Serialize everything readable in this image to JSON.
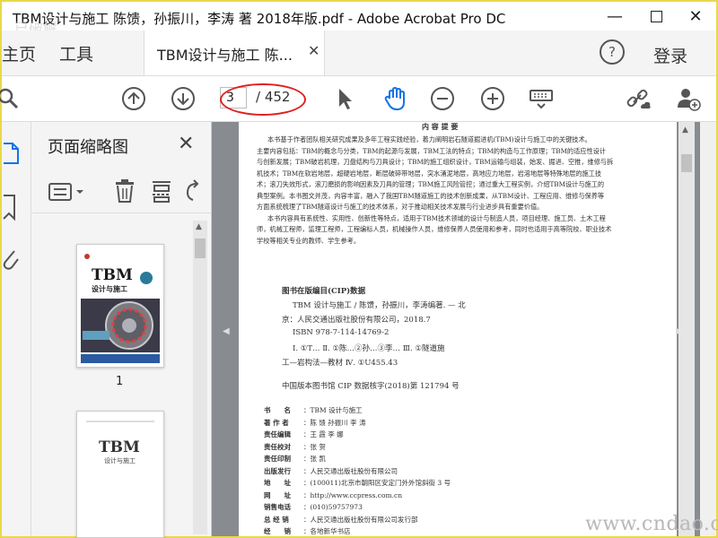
{
  "window": {
    "title": "TBM设计与施工 陈馈，孙振川，李涛 著 2018年版.pdf - Adobe Acrobat Pro DC",
    "corner_logo": "已破解"
  },
  "tabs": {
    "home": "主页",
    "tools": "工具",
    "document": "TBM设计与施工 陈...",
    "login": "登录"
  },
  "toolbar": {
    "page_current": "3",
    "page_total": "/ 452"
  },
  "thumbnail_panel": {
    "title": "页面缩略图",
    "thumbnails": [
      {
        "label": "1",
        "cover_title": "TBM",
        "cover_subtitle": "设计与施工"
      },
      {
        "label": "",
        "cover_title": "TBM",
        "cover_subtitle": "设计与施工"
      }
    ]
  },
  "document": {
    "summary_heading": "内 容 提 要",
    "summary_lines": [
      "本书基于作者团队相关研究成果及多年工程实践经验，着力阐明岩石隧道掘进机(TBM)设计与施工中的关键技术。",
      "主要内容包括：TBM的概念与分类，TBM的起源与发展，TBM工法的特点；TBM的构造与工作原理；TBM的适应性设计",
      "与创新发展；TBM破岩机理，刀盘结构与刀具设计；TBM的施工组织设计，TBM运输与组装，始发、掘进、空推，维修与拆",
      "机技术；TBM在软岩地层，超硬岩地层，断层破碎带地层，突水涌泥地层，高地应力地层，岩溶地层等特殊地层的施工技",
      "术；滚刀失效形式，滚刀磨损的影响因素及刀具的管理；TBM施工风险管控；通过重大工程实例，介绍TBM设计与施工的",
      "典型案例。本书图文并茂，内容丰富，融入了我国TBM隧道施工的技术创新成果，从TBM设计、工程应用、维修与保养等",
      "方面系统梳理了TBM隧道设计与施工的技术体系，对于推动相关技术发展与行业进步具有重要价值。",
      "本书内容具有系统性、实用性、创新性等特点，适用于TBM技术领域的设计与制造人员，项目经理、施工员、土木工程",
      "师，机械工程师，监理工程师，工程编标人员，机械操作人员，维修保养人员使用和参考，同时也适用于高等院校、职业技术",
      "学校等相关专业的教师、学生参考。"
    ],
    "cip_heading": "图书在版编目(CIP)数据",
    "cip_lines": [
      "TBM 设计与施工 / 陈馈，孙振川，李涛编著. — 北",
      "京：人民交通出版社股份有限公司，2018.7",
      "ISBN 978-7-114-14769-2",
      "Ⅰ. ①T…  Ⅱ. ①陈…②孙…③李…  Ⅲ. ①隧道施",
      "工—岩构法—教材  Ⅳ. ①U455.43",
      "中国版本图书馆 CIP 数据核字(2018)第 121794 号"
    ],
    "meta": [
      {
        "k": "书　　名",
        "v": "TBM 设计与施工"
      },
      {
        "k": "著 作 者",
        "v": "陈 馈  孙振川  李 涛"
      },
      {
        "k": "责任编辑",
        "v": "王 霞  李 娜"
      },
      {
        "k": "责任校对",
        "v": "张 贺"
      },
      {
        "k": "责任印制",
        "v": "张 凯"
      },
      {
        "k": "出版发行",
        "v": "人民交通出版社股份有限公司"
      },
      {
        "k": "地　　址",
        "v": "(100011)北京市朝阳区安定门外外馆斜街 3 号"
      },
      {
        "k": "网　　址",
        "v": "http://www.ccpress.com.cn"
      },
      {
        "k": "销售电话",
        "v": "(010)59757973"
      },
      {
        "k": "总 经 销",
        "v": "人民交通出版社股份有限公司发行部"
      },
      {
        "k": "经　　销",
        "v": "各地新华书店"
      }
    ]
  },
  "watermark": "www.cndao.com",
  "colors": {
    "accent_blue": "#1473e6",
    "highlight_red": "#e02020",
    "frame_yellow": "#e8d84a"
  }
}
